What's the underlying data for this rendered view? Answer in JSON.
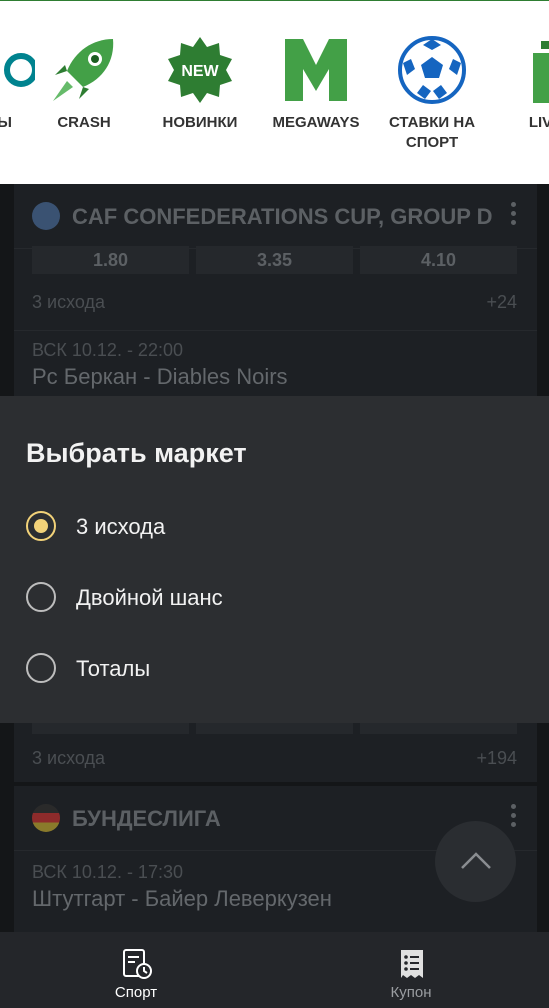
{
  "categories": [
    {
      "label": "ТЫ",
      "icon": "partial-icon"
    },
    {
      "label": "CRASH",
      "icon": "rocket-icon"
    },
    {
      "label": "НОВИНКИ",
      "icon": "new-badge-icon",
      "badge": "NEW"
    },
    {
      "label": "MEGAWAYS",
      "icon": "megaways-m-icon",
      "badge": "M"
    },
    {
      "label": "СТАВКИ НА СПОРТ",
      "icon": "soccer-ball-icon"
    },
    {
      "label": "LIVE-",
      "icon": "live-play-icon"
    }
  ],
  "events": {
    "league1": {
      "title": "CAF CONFEDERATIONS CUP, GROUP D",
      "icon": "globe-icon",
      "odds": [
        "1.80",
        "3.35",
        "4.10"
      ],
      "market": "3 исхода",
      "more": "+24",
      "match": {
        "time": "ВСК 10.12. - 22:00",
        "teams": "Рс Беркан - Diables Noirs"
      }
    },
    "league2": {
      "market": "3 исхода",
      "more": "+194"
    },
    "league3": {
      "title": "БУНДЕСЛИГА",
      "icon": "germany-flag-icon",
      "match": {
        "time": "ВСК 10.12. - 17:30",
        "teams": "Штутгарт - Байер Леверкузен"
      }
    }
  },
  "market_sheet": {
    "title": "Выбрать маркет",
    "options": [
      {
        "label": "3 исхода",
        "selected": true
      },
      {
        "label": "Двойной шанс",
        "selected": false
      },
      {
        "label": "Тоталы",
        "selected": false
      }
    ],
    "accent": "#f2d279"
  },
  "bottom_nav": [
    {
      "label": "Спорт",
      "icon": "sport-clock-list-icon",
      "active": true
    },
    {
      "label": "Купон",
      "icon": "coupon-list-icon",
      "active": false
    }
  ],
  "colors": {
    "brand_green": "#2e7d32",
    "background": "#17191c"
  }
}
